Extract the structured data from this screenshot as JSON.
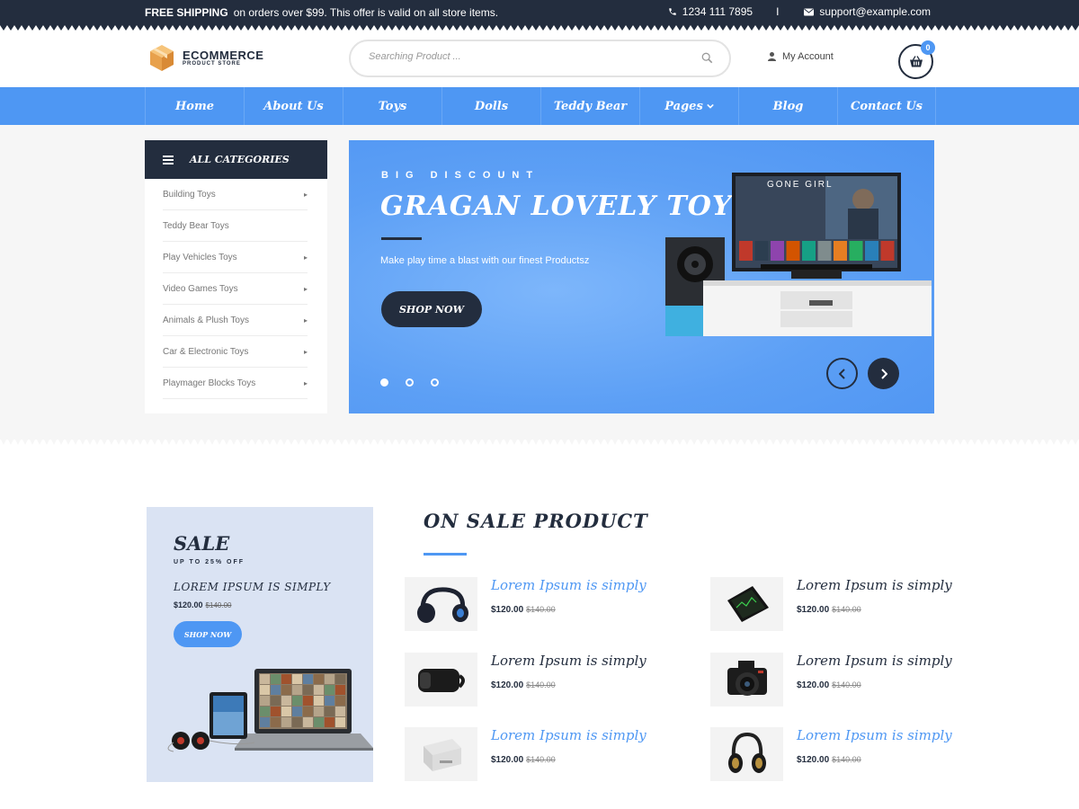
{
  "topbar": {
    "shipping_bold": "FREE SHIPPING",
    "shipping_text": "on orders over $99. This offer is valid on all store items.",
    "phone": "1234 111 7895",
    "separator": "I",
    "email": "support@example.com"
  },
  "header": {
    "logo_title": "ECOMMERCE",
    "logo_subtitle": "PRODUCT STORE",
    "search_placeholder": "Searching Product ...",
    "account_label": "My Account",
    "cart_count": "0"
  },
  "nav": {
    "items": [
      "Home",
      "About Us",
      "Toys",
      "Dolls",
      "Teddy Bear",
      "Pages",
      "Blog",
      "Contact Us"
    ]
  },
  "categories": {
    "title": "ALL CATEGORIES",
    "items": [
      "Building Toys",
      "Teddy Bear  Toys",
      "Play Vehicles  Toys",
      "Video Games  Toys",
      "Animals & Plush Toys",
      "Car & Electronic Toys",
      "Playmager Blocks Toys"
    ]
  },
  "slider": {
    "kicker": "BIG DISCOUNT",
    "title": "GRAGAN LOVELY TOY",
    "subtitle": "Make play time a blast with our finest Productsz",
    "button": "SHOP NOW",
    "tv_title": "GONE GIRL",
    "slide_count": 3,
    "active_slide": 1
  },
  "sale_banner": {
    "title": "SALE",
    "subtitle": "UP TO 25% OFF",
    "product_name": "LOREM IPSUM IS SIMPLY",
    "price": "$120.00",
    "old_price": "$140.00",
    "button": "SHOP NOW"
  },
  "on_sale": {
    "title": "ON SALE PRODUCT",
    "products": [
      {
        "name": "Lorem Ipsum is simply",
        "price": "$120.00",
        "old_price": "$140.00",
        "icon": "headphones-icon",
        "highlight": true
      },
      {
        "name": "Lorem Ipsum is simply",
        "price": "$120.00",
        "old_price": "$140.00",
        "icon": "tablet-icon",
        "highlight": false
      },
      {
        "name": "Lorem Ipsum is simply",
        "price": "$120.00",
        "old_price": "$140.00",
        "icon": "vr-headset-icon",
        "highlight": false
      },
      {
        "name": "Lorem Ipsum is simply",
        "price": "$120.00",
        "old_price": "$140.00",
        "icon": "camera-icon",
        "highlight": false
      },
      {
        "name": "Lorem Ipsum is simply",
        "price": "$120.00",
        "old_price": "$140.00",
        "icon": "printer-icon",
        "highlight": true
      },
      {
        "name": "Lorem Ipsum is simply",
        "price": "$120.00",
        "old_price": "$140.00",
        "icon": "studio-headphones-icon",
        "highlight": true
      }
    ]
  },
  "colors": {
    "navy": "#232d3e",
    "blue": "#4e97f3",
    "sale_bg": "#dae3f3"
  }
}
